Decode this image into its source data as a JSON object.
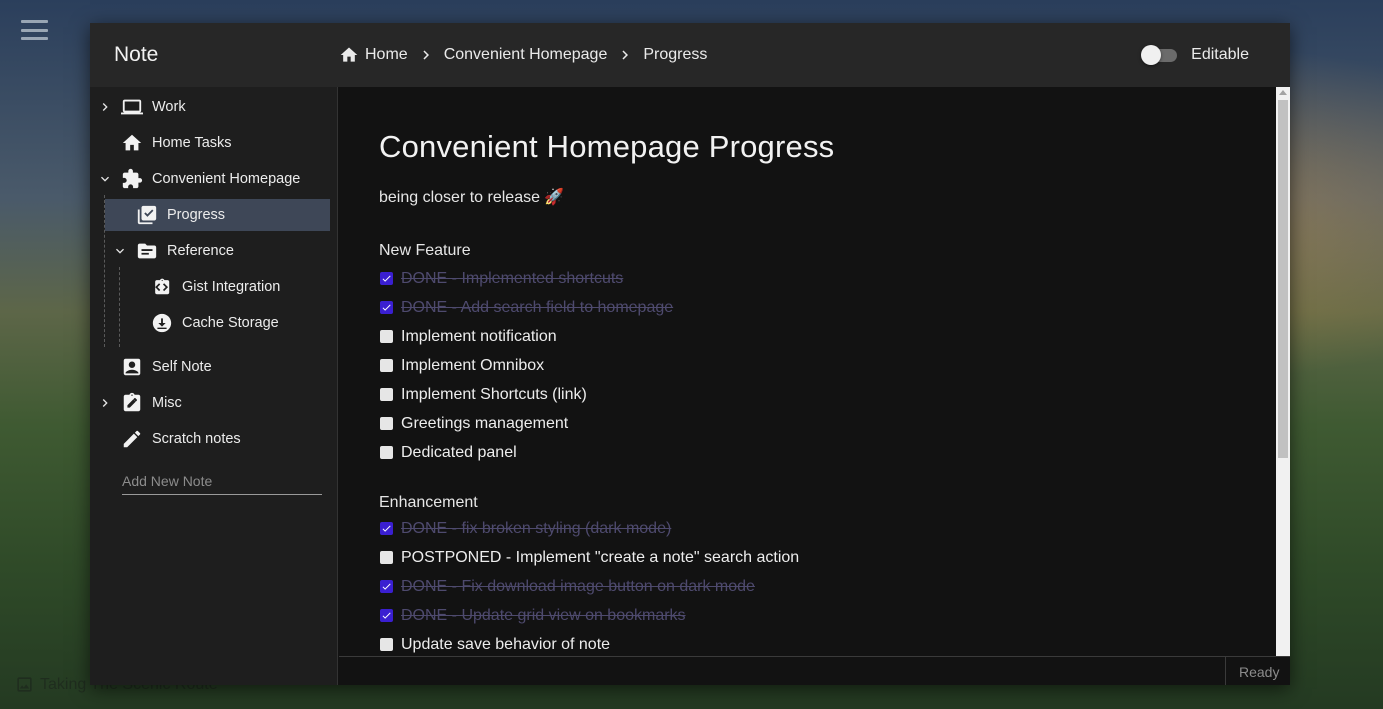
{
  "app": {
    "title": "Note"
  },
  "breadcrumb": {
    "items": [
      "Home",
      "Convenient Homepage",
      "Progress"
    ]
  },
  "toggle": {
    "label": "Editable",
    "checked": false
  },
  "sidebar": {
    "items": [
      {
        "label": "Work",
        "icon": "laptop-icon",
        "expandable": true,
        "expanded": false
      },
      {
        "label": "Home Tasks",
        "icon": "home-icon",
        "expandable": false
      },
      {
        "label": "Convenient Homepage",
        "icon": "puzzle-icon",
        "expandable": true,
        "expanded": true
      },
      {
        "label": "Progress",
        "icon": "library-add-check-icon",
        "selected": true
      },
      {
        "label": "Reference",
        "icon": "folder-icon",
        "expandable": true,
        "expanded": true
      },
      {
        "label": "Gist Integration",
        "icon": "code-clipboard-icon"
      },
      {
        "label": "Cache Storage",
        "icon": "download-circle-icon"
      },
      {
        "label": "Self Note",
        "icon": "contact-card-icon"
      },
      {
        "label": "Misc",
        "icon": "clipboard-edit-icon",
        "expandable": true,
        "expanded": false
      },
      {
        "label": "Scratch notes",
        "icon": "pencil-icon"
      }
    ],
    "add_note_placeholder": "Add New Note"
  },
  "document": {
    "title": "Convenient Homepage Progress",
    "subtitle": "being closer to release 🚀",
    "sections": [
      {
        "title": "New Feature",
        "tasks": [
          {
            "text": "DONE - Implemented shortcuts",
            "done": true
          },
          {
            "text": "DONE - Add search field to homepage",
            "done": true
          },
          {
            "text": "Implement notification",
            "done": false
          },
          {
            "text": "Implement Omnibox",
            "done": false
          },
          {
            "text": "Implement Shortcuts (link)",
            "done": false
          },
          {
            "text": "Greetings management",
            "done": false
          },
          {
            "text": "Dedicated panel",
            "done": false
          }
        ]
      },
      {
        "title": "Enhancement",
        "tasks": [
          {
            "text": "DONE - fix broken styling (dark mode)",
            "done": true
          },
          {
            "text": "POSTPONED - Implement \"create a note\" search action",
            "done": false
          },
          {
            "text": "DONE - Fix download image button on dark mode",
            "done": true
          },
          {
            "text": "DONE - Update grid view on bookmarks",
            "done": true
          },
          {
            "text": "Update save behavior of note",
            "done": false
          }
        ]
      }
    ]
  },
  "status": {
    "text": "Ready"
  },
  "background": {
    "caption": "Taking The Scenic Route"
  },
  "colors": {
    "checkbox_checked": "#3a1fd1",
    "selected_item": "#3e4757",
    "done_text": "#4e4a6e"
  }
}
